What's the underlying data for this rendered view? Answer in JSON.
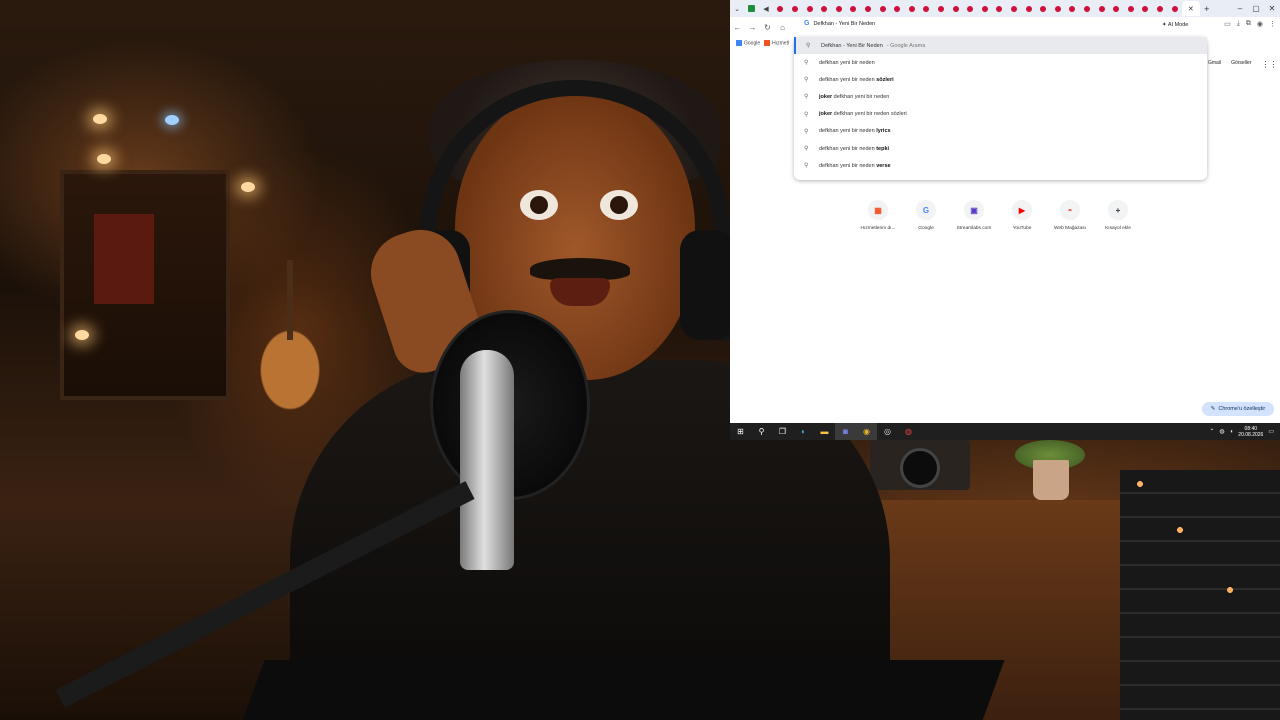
{
  "browser": {
    "tab_count_visible": 30,
    "address_text": "Defkhan - Yeni Bir Neden",
    "ai_mode_label": "AI Mode",
    "bookmarks": [
      "Google",
      "Hızmetl"
    ],
    "google_apps": [
      "Gmail",
      "Görseller"
    ]
  },
  "suggestions": [
    {
      "prefix": "Defkhan - Yeni Bir Neden",
      "bold": "",
      "hint": "- Google Arama",
      "selected": true
    },
    {
      "prefix": "defkhan yeni bir neden",
      "bold": "",
      "hint": "",
      "selected": false
    },
    {
      "prefix": "defkhan yeni bir neden ",
      "bold": "sözleri",
      "hint": "",
      "selected": false
    },
    {
      "prefix": "",
      "bold": "joker",
      "suffix": " defkhan yeni bir neden",
      "hint": "",
      "selected": false
    },
    {
      "prefix": "",
      "bold": "joker",
      "suffix": " defkhan yeni bir neden sözleri",
      "hint": "",
      "selected": false
    },
    {
      "prefix": "defkhan yeni bir neden ",
      "bold": "lyrics",
      "hint": "",
      "selected": false
    },
    {
      "prefix": "defkhan yeni bir neden ",
      "bold": "tepki",
      "hint": "",
      "selected": false
    },
    {
      "prefix": "defkhan yeni bir neden ",
      "bold": "verse",
      "hint": "",
      "selected": false
    }
  ],
  "shortcuts": [
    {
      "label": "Hızmetlerim dı...",
      "icon": "microsoft-icon",
      "glyph": "▦",
      "color": "#f25022"
    },
    {
      "label": "Google",
      "icon": "google-icon",
      "glyph": "G",
      "color": "#4285f4"
    },
    {
      "label": "Streamlabs.com",
      "icon": "streamlabs-icon",
      "glyph": "▣",
      "color": "#5b3cc4"
    },
    {
      "label": "YouTube",
      "icon": "youtube-icon",
      "glyph": "▶",
      "color": "#ff0000"
    },
    {
      "label": "Web Mağazası",
      "icon": "webstore-icon",
      "glyph": "◓",
      "color": "#ea4335"
    },
    {
      "label": "Kısayol ekle",
      "icon": "add-icon",
      "glyph": "+",
      "color": "#333333"
    }
  ],
  "customize_label": "Chrome'u özelleştir",
  "taskbar": {
    "apps": [
      "start-icon",
      "search-icon",
      "taskview-icon",
      "edge-icon",
      "explorer-icon",
      "discord-icon",
      "chrome-icon",
      "obs-icon",
      "app-icon"
    ],
    "time": "08:40",
    "date": "20.08.2026"
  }
}
